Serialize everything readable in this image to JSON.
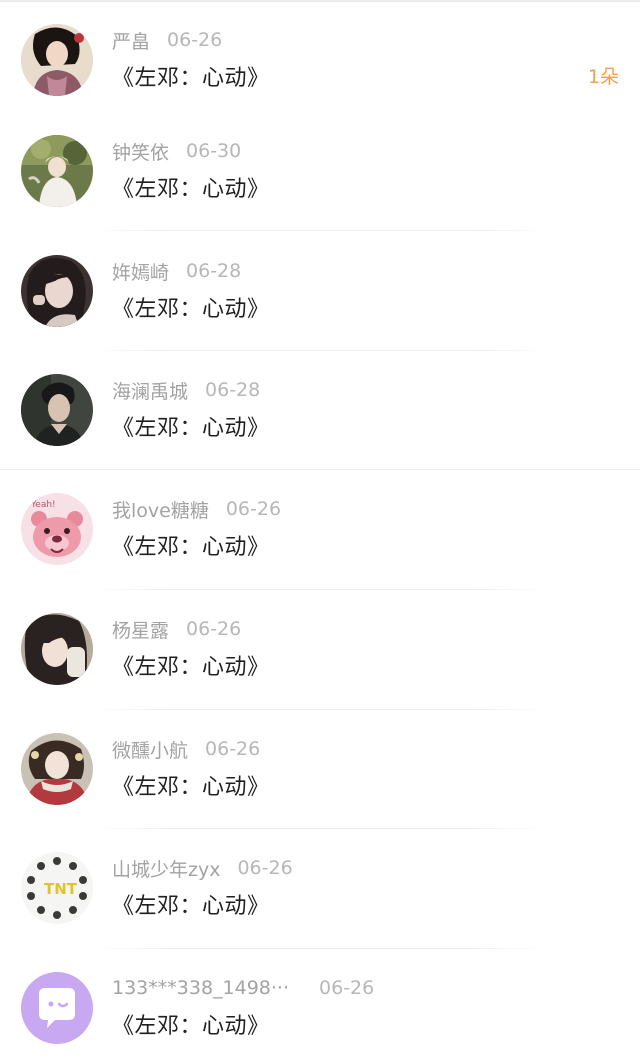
{
  "list": {
    "items": [
      {
        "name": "严畠",
        "date": "06-26",
        "title": "《左邓：心动》",
        "badge": "1朵",
        "avatar": "avatar-woman-portrait-icon"
      },
      {
        "name": "钟笑依",
        "date": "06-30",
        "title": "《左邓：心动》",
        "badge": "",
        "avatar": "avatar-girl-outdoor-icon"
      },
      {
        "name": "姩嫣崎",
        "date": "06-28",
        "title": "《左邓：心动》",
        "badge": "",
        "avatar": "avatar-girl-selfie-icon"
      },
      {
        "name": "海澜禹城",
        "date": "06-28",
        "title": "《左邓：心动》",
        "badge": "",
        "avatar": "avatar-man-portrait-icon"
      },
      {
        "name": "我love糖糖",
        "date": "06-26",
        "title": "《左邓：心动》",
        "badge": "",
        "avatar": "avatar-pink-bear-icon"
      },
      {
        "name": "杨星露",
        "date": "06-26",
        "title": "《左邓：心动》",
        "badge": "",
        "avatar": "avatar-girl-closeup-icon"
      },
      {
        "name": "微醺小航",
        "date": "06-26",
        "title": "《左邓：心动》",
        "badge": "",
        "avatar": "avatar-girl-scarf-icon"
      },
      {
        "name": "山城少年zyx",
        "date": "06-26",
        "title": "《左邓：心动》",
        "badge": "",
        "avatar": "avatar-cartoon-circle-icon"
      },
      {
        "name": "133***338_1498···",
        "date": "06-26",
        "title": "《左邓：心动》",
        "badge": "",
        "avatar": "avatar-chat-default-icon"
      }
    ]
  },
  "colors": {
    "username": "#a3a3a3",
    "date": "#b7b7b7",
    "title": "#1f1f1f",
    "badge": "#f0a04c",
    "divider": "#ececec",
    "default_avatar": "#c9a8f2"
  }
}
